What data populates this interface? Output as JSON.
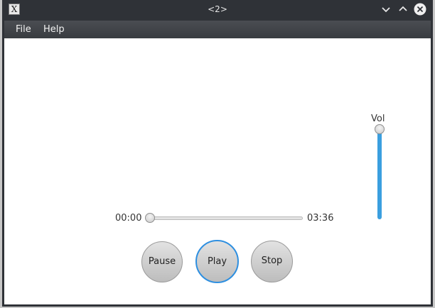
{
  "window": {
    "title": "<2>",
    "app_icon": "x-window-icon",
    "controls": [
      "minimize-icon",
      "maximize-icon",
      "close-icon"
    ]
  },
  "menu": {
    "items": [
      {
        "label": "File"
      },
      {
        "label": "Help"
      }
    ]
  },
  "player": {
    "current_time": "00:00",
    "total_time": "03:36",
    "seek_position": 0,
    "volume_label": "Vol",
    "volume_level": 1.0,
    "buttons": {
      "pause": "Pause",
      "play": "Play",
      "stop": "Stop"
    },
    "focused_button": "play"
  },
  "colors": {
    "accent": "#3b9fdf",
    "titlebar": "#2f3237",
    "focus_ring": "#2e8fe0"
  }
}
